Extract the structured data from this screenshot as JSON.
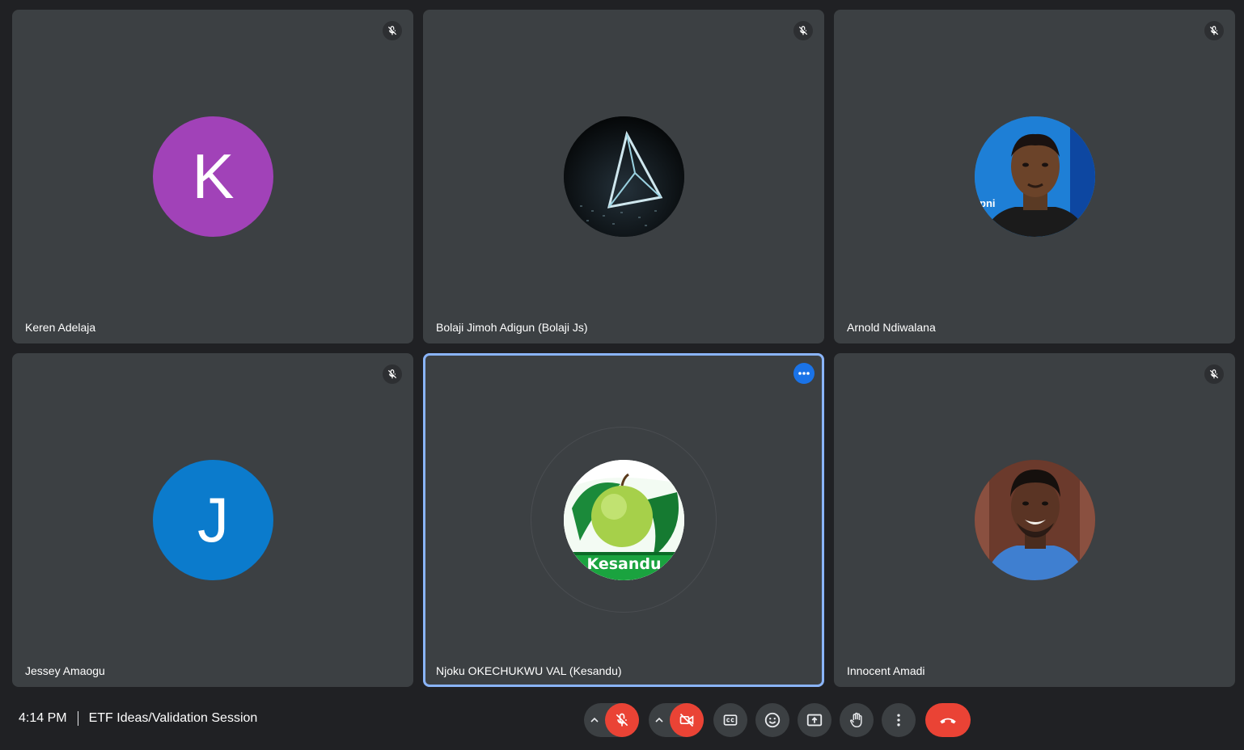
{
  "tiles": [
    {
      "name": "Keren Adelaja",
      "avatar_letter": "K",
      "avatar_color": "#a142b8",
      "muted": true
    },
    {
      "name": "Bolaji Jimoh Adigun (Bolaji Js)",
      "avatar_image": "triangle-logo-photo",
      "muted": true
    },
    {
      "name": "Arnold Ndiwalana",
      "avatar_image": "man-portrait-photo",
      "muted": true
    },
    {
      "name": "Jessey Amaogu",
      "avatar_letter": "J",
      "avatar_color": "#0b7bcc",
      "muted": true
    },
    {
      "name": "Njoku OKECHUKWU VAL (Kesandu)",
      "avatar_image": "kesandu-apple-logo",
      "avatar_text": "Kesandu",
      "active": true
    },
    {
      "name": "Innocent Amadi",
      "avatar_image": "smiling-man-portrait-photo",
      "muted": true
    }
  ],
  "meeting": {
    "time": "4:14 PM",
    "title": "ETF Ideas/Validation Session"
  },
  "controls": {
    "mic": "mic-off-icon",
    "camera": "camera-off-icon",
    "captions": "closed-captions-icon",
    "reactions": "emoji-icon",
    "present": "present-screen-icon",
    "raise_hand": "raise-hand-icon",
    "more": "more-vert-icon",
    "leave": "hang-up-icon"
  },
  "colors": {
    "tile_bg": "#3c4043",
    "page_bg": "#202124",
    "danger": "#ea4335",
    "active_border": "#8ab4f8"
  }
}
